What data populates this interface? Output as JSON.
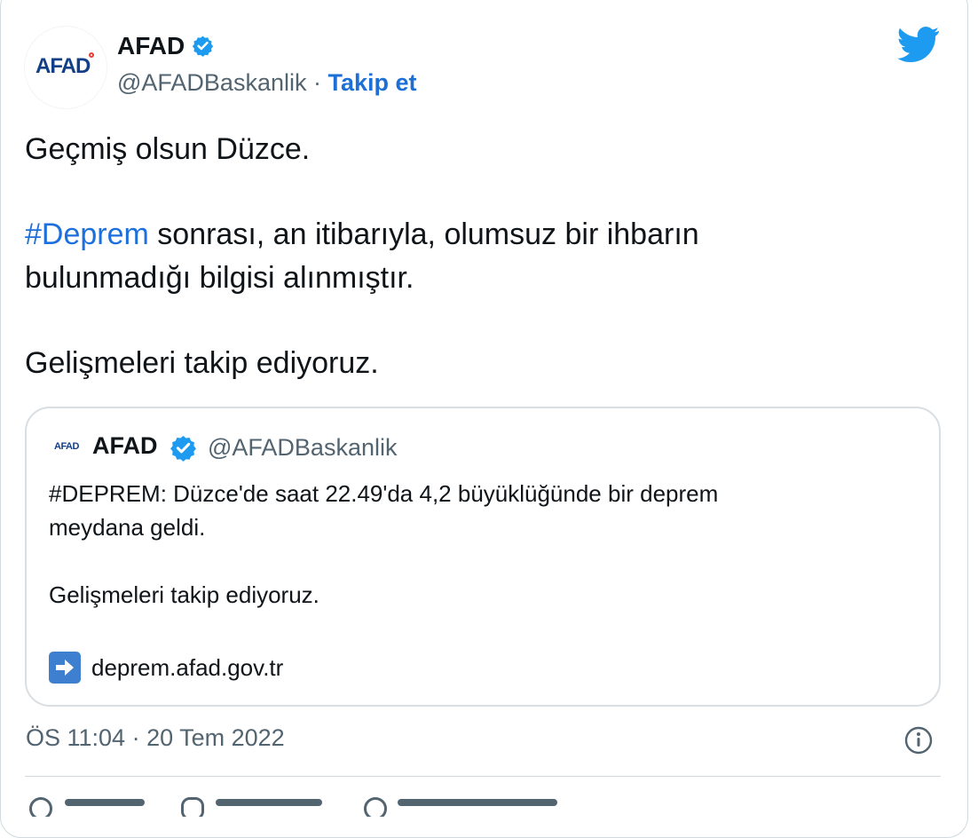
{
  "tweet": {
    "avatar_text": "AFAD",
    "display_name": "AFAD",
    "handle": "@AFADBaskanlik",
    "separator": "·",
    "follow_label": "Takip et",
    "text": {
      "line1": "Geçmiş olsun Düzce.",
      "hashtag": "#Deprem",
      "line2_rest": " sonrası, an itibarıyla, olumsuz bir ihbarın",
      "line3": "bulunmadığı bilgisi alınmıştır.",
      "line4": "Gelişmeleri takip ediyoruz."
    },
    "timestamp": "ÖS 11:04 · 20 Tem 2022"
  },
  "quoted_tweet": {
    "avatar_text": "AFAD",
    "display_name": "AFAD",
    "handle": "@AFADBaskanlik",
    "line1": "#DEPREM: Düzce'de saat 22.49'da 4,2 büyüklüğünde bir deprem",
    "line2": "meydana geldi.",
    "line3": "Gelişmeleri takip ediyoruz.",
    "link": "deprem.afad.gov.tr"
  },
  "icons": {
    "verified": "verified-badge-icon",
    "twitter": "twitter-bird-icon",
    "info": "info-icon",
    "link_arrow": "right-arrow-box-icon"
  },
  "colors": {
    "text": "#0f1419",
    "secondary_text": "#536471",
    "link_blue": "#1d70dc",
    "verified_blue": "#1d9bf0",
    "border": "#cfd9de"
  }
}
